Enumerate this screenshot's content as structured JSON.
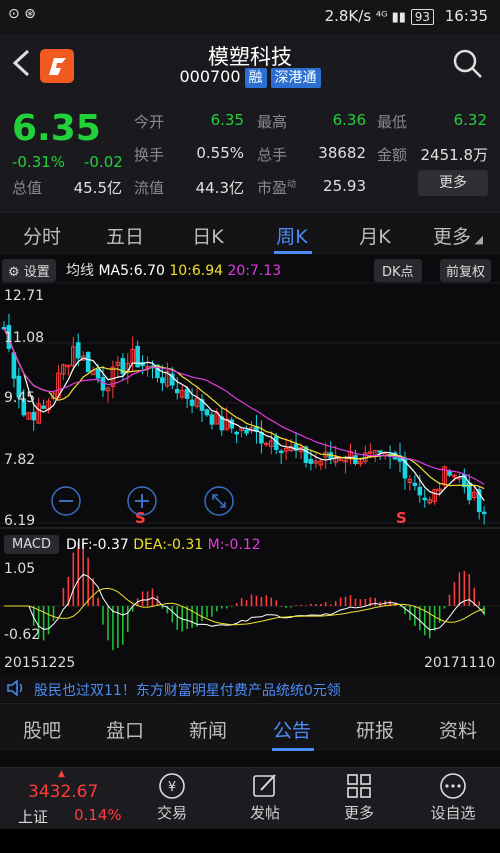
{
  "status_bar": {
    "speed": "2.8K/s",
    "battery": "93",
    "time": "16:35"
  },
  "header": {
    "name": "模塑科技",
    "code": "000700",
    "tag1": "融",
    "tag2": "深港通"
  },
  "quote": {
    "price": "6.35",
    "change_pct": "-0.31%",
    "change": "-0.02",
    "market_cap_label": "总值",
    "market_cap": "45.5亿",
    "open_label": "今开",
    "open": "6.35",
    "high_label": "最高",
    "high": "6.36",
    "low_label": "最低",
    "low": "6.32",
    "turnover_label": "换手",
    "turnover": "0.55%",
    "volume_label": "总手",
    "volume": "38682",
    "amount_label": "金额",
    "amount": "2451.8万",
    "float_label": "流值",
    "float_cap": "44.3亿",
    "pe_label": "市盈",
    "pe_sup": "动",
    "pe": "25.93",
    "more_button": "更多"
  },
  "tabs": [
    "分时",
    "五日",
    "日K",
    "周K",
    "月K",
    "更多"
  ],
  "chart": {
    "settings": "设置",
    "ma_title": "均线",
    "ma5": "MA5:6.70",
    "ma10": "10:6.94",
    "ma20": "20:7.13",
    "dk_button": "DK点",
    "adjust_button": "前复权",
    "y_labels": [
      "12.71",
      "11.08",
      "9.45",
      "7.82",
      "6.19"
    ],
    "macd_button": "MACD",
    "dif": "DIF:-0.37",
    "dea": "DEA:-0.31",
    "m": "M:-0.12",
    "macd_top": "1.05",
    "macd_bottom": "-0.62",
    "date_start": "20151225",
    "date_end": "20171110",
    "s_marker": "S",
    "colors": {
      "ma5": "#ffffff",
      "ma10": "#f2e12c",
      "ma20": "#e03be0",
      "up": "#ff3b3b",
      "down": "#18d4e0"
    }
  },
  "ticker": "股民也过双11！东方财富明星付费产品统统0元领",
  "bottom_tabs": [
    "股吧",
    "盘口",
    "新闻",
    "公告",
    "研报",
    "资料"
  ],
  "bottom_bar": {
    "index_value": "3432.67",
    "index_name": "上证",
    "index_change": "0.14%",
    "items": [
      "交易",
      "发帖",
      "更多",
      "设自选"
    ]
  }
}
